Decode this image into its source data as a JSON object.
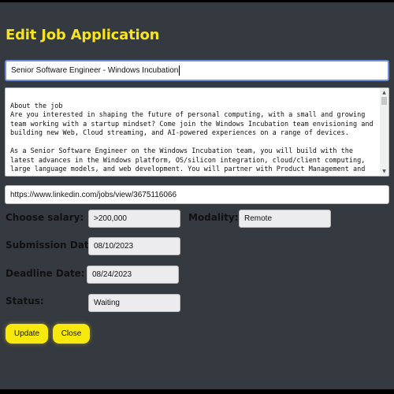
{
  "page": {
    "title": "Edit Job Application"
  },
  "form": {
    "job_title": "Senior Software Engineer - Windows Incubation",
    "description": "\nAbout the job\nAre you interested in shaping the future of personal computing, with a small and growing\nteam working with a startup mindset? Come join the Windows Incubation team envisioning and\nbuilding new Web, Cloud streaming, and AI-powered experiences on a range of devices.\n\nAs a Senior Software Engineer on the Windows Incubation team, you will build with the\nlatest advances in the Windows platform, OS/silicon integration, cloud/client computing,\nlarge language models, and web development. You will partner with Product Management and",
    "url": "https://www.linkedin.com/jobs/view/3675116066",
    "salary_label": "Choose salary:",
    "salary": ">200,000",
    "modality_label": "Modality:",
    "modality": "Remote",
    "submission_label": "Submission Date:",
    "submission_date": "08/10/2023",
    "deadline_label": "Deadline Date:",
    "deadline_date": "08/24/2023",
    "status_label": "Status:",
    "status": "Waiting"
  },
  "buttons": {
    "update": "Update",
    "close": "Close"
  },
  "colors": {
    "accent": "#f7e41c",
    "background": "#353940"
  }
}
